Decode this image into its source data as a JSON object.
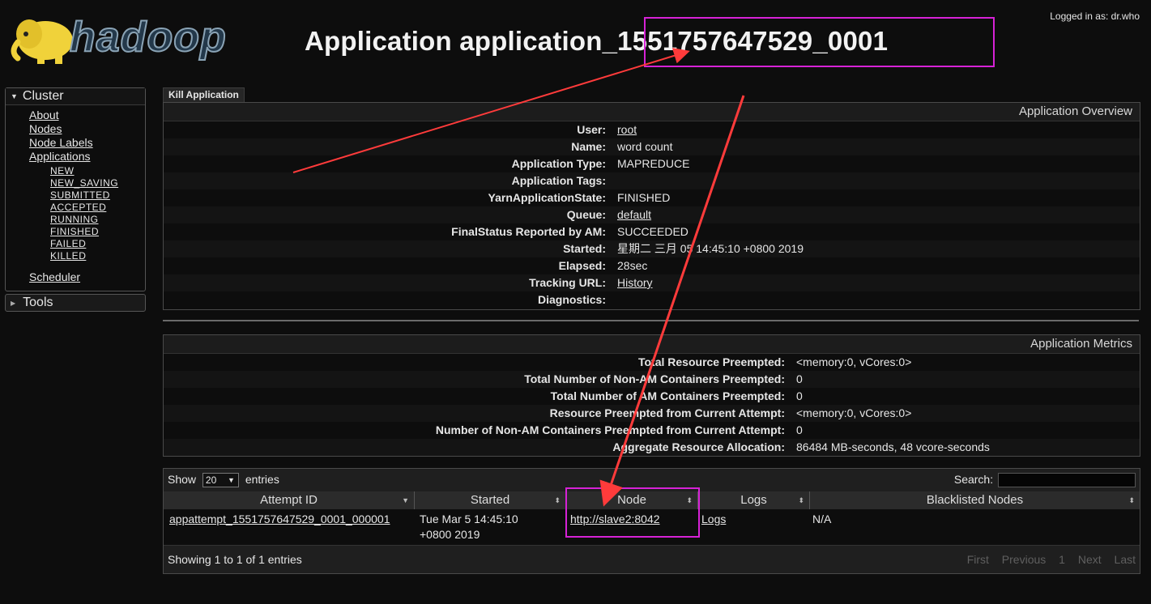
{
  "header": {
    "logo_text": "hadoop",
    "title": "Application application_1551757647529_0001",
    "logged_in": "Logged in as: dr.who"
  },
  "sidebar": {
    "cluster_label": "Cluster",
    "links": [
      "About",
      "Nodes",
      "Node Labels",
      "Applications"
    ],
    "app_states": [
      "NEW",
      "NEW_SAVING",
      "SUBMITTED",
      "ACCEPTED",
      "RUNNING",
      "FINISHED",
      "FAILED",
      "KILLED"
    ],
    "scheduler": "Scheduler",
    "tools_label": "Tools"
  },
  "kill_tab": "Kill Application",
  "overview": {
    "heading": "Application Overview",
    "rows": [
      {
        "k": "User:",
        "v": "root"
      },
      {
        "k": "Name:",
        "v": "word count"
      },
      {
        "k": "Application Type:",
        "v": "MAPREDUCE"
      },
      {
        "k": "Application Tags:",
        "v": ""
      },
      {
        "k": "YarnApplicationState:",
        "v": "FINISHED"
      },
      {
        "k": "Queue:",
        "v": "default"
      },
      {
        "k": "FinalStatus Reported by AM:",
        "v": "SUCCEEDED"
      },
      {
        "k": "Started:",
        "v": "星期二 三月 05 14:45:10 +0800 2019"
      },
      {
        "k": "Elapsed:",
        "v": "28sec"
      },
      {
        "k": "Tracking URL:",
        "v": "History"
      },
      {
        "k": "Diagnostics:",
        "v": ""
      }
    ]
  },
  "metrics": {
    "heading": "Application Metrics",
    "rows": [
      {
        "k": "Total Resource Preempted:",
        "v": "<memory:0, vCores:0>"
      },
      {
        "k": "Total Number of Non-AM Containers Preempted:",
        "v": "0"
      },
      {
        "k": "Total Number of AM Containers Preempted:",
        "v": "0"
      },
      {
        "k": "Resource Preempted from Current Attempt:",
        "v": "<memory:0, vCores:0>"
      },
      {
        "k": "Number of Non-AM Containers Preempted from Current Attempt:",
        "v": "0"
      },
      {
        "k": "Aggregate Resource Allocation:",
        "v": "86484 MB-seconds, 48 vcore-seconds"
      }
    ]
  },
  "attempts": {
    "show_label": "Show",
    "page_size": "20",
    "entries_label": "entries",
    "search_label": "Search:",
    "columns": [
      "Attempt ID",
      "Started",
      "Node",
      "Logs",
      "Blacklisted Nodes"
    ],
    "row": {
      "attempt_id": "appattempt_1551757647529_0001_000001",
      "started_line1": "Tue Mar 5 14:45:10",
      "started_line2": "+0800 2019",
      "node": "http://slave2:8042",
      "logs": "Logs",
      "blacklisted": "N/A"
    },
    "info": "Showing 1 to 1 of 1 entries",
    "pager": [
      "First",
      "Previous",
      "1",
      "Next",
      "Last"
    ]
  },
  "colors": {
    "highlight": "#d622d6",
    "arrow": "#ff3b3b"
  }
}
